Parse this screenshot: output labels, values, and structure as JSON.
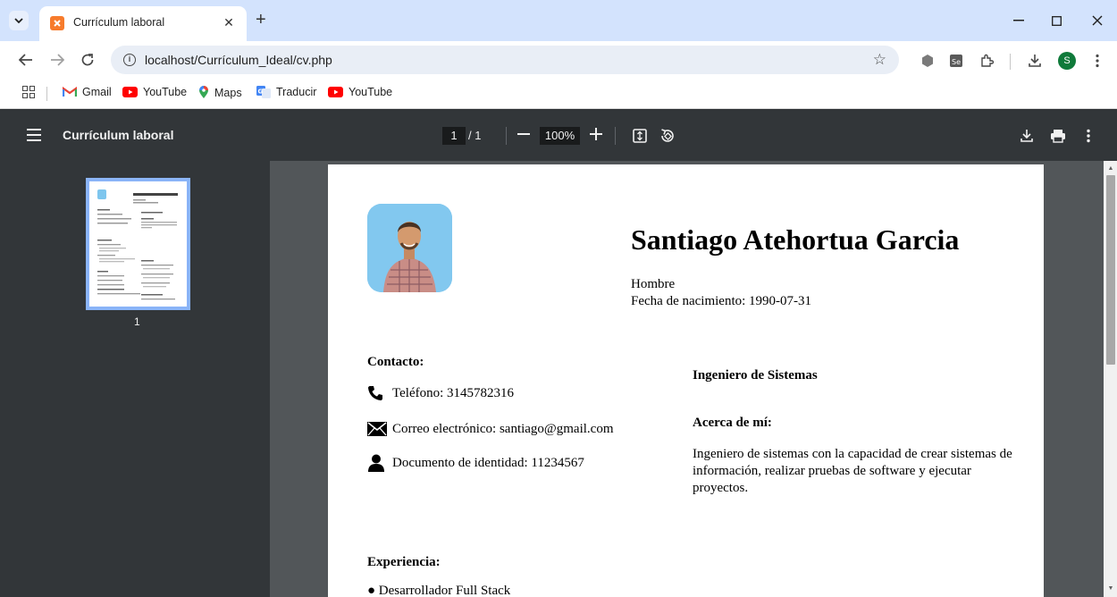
{
  "browser": {
    "tab_title": "Currículum laboral",
    "url": "localhost/Currículum_Ideal/cv.php",
    "profile_initial": "S",
    "bookmarks": [
      {
        "label": "Gmail",
        "icon": "gmail-icon"
      },
      {
        "label": "YouTube",
        "icon": "youtube-icon"
      },
      {
        "label": "Maps",
        "icon": "maps-icon"
      },
      {
        "label": "Traducir",
        "icon": "translate-icon"
      },
      {
        "label": "YouTube",
        "icon": "youtube-icon"
      }
    ]
  },
  "pdf_viewer": {
    "title": "Currículum laboral",
    "current_page": "1",
    "page_total": "/ 1",
    "zoom": "100%",
    "thumbnail_label": "1"
  },
  "cv": {
    "name": "Santiago Atehortua Garcia",
    "gender": "Hombre",
    "birth": "Fecha de nacimiento: 1990-07-31",
    "contact_heading": "Contacto:",
    "phone": "Teléfono: 3145782316",
    "email": "Correo electrónico: santiago@gmail.com",
    "document": "Documento de identidad: 11234567",
    "profession": "Ingeniero de Sistemas",
    "about_heading": "Acerca de mí:",
    "about_text": "Ingeniero de sistemas con la capacidad de crear sistemas de información, realizar pruebas de software y ejecutar proyectos.",
    "experience_heading": "Experiencia:",
    "experience_item": "● Desarrollador Full Stack"
  },
  "colors": {
    "tabstrip": "#d3e3fd",
    "pdf_toolbar": "#323639",
    "pdf_canvas": "#525659",
    "thumbnail_border": "#8ab4f8",
    "profile": "#0f7a3a"
  }
}
